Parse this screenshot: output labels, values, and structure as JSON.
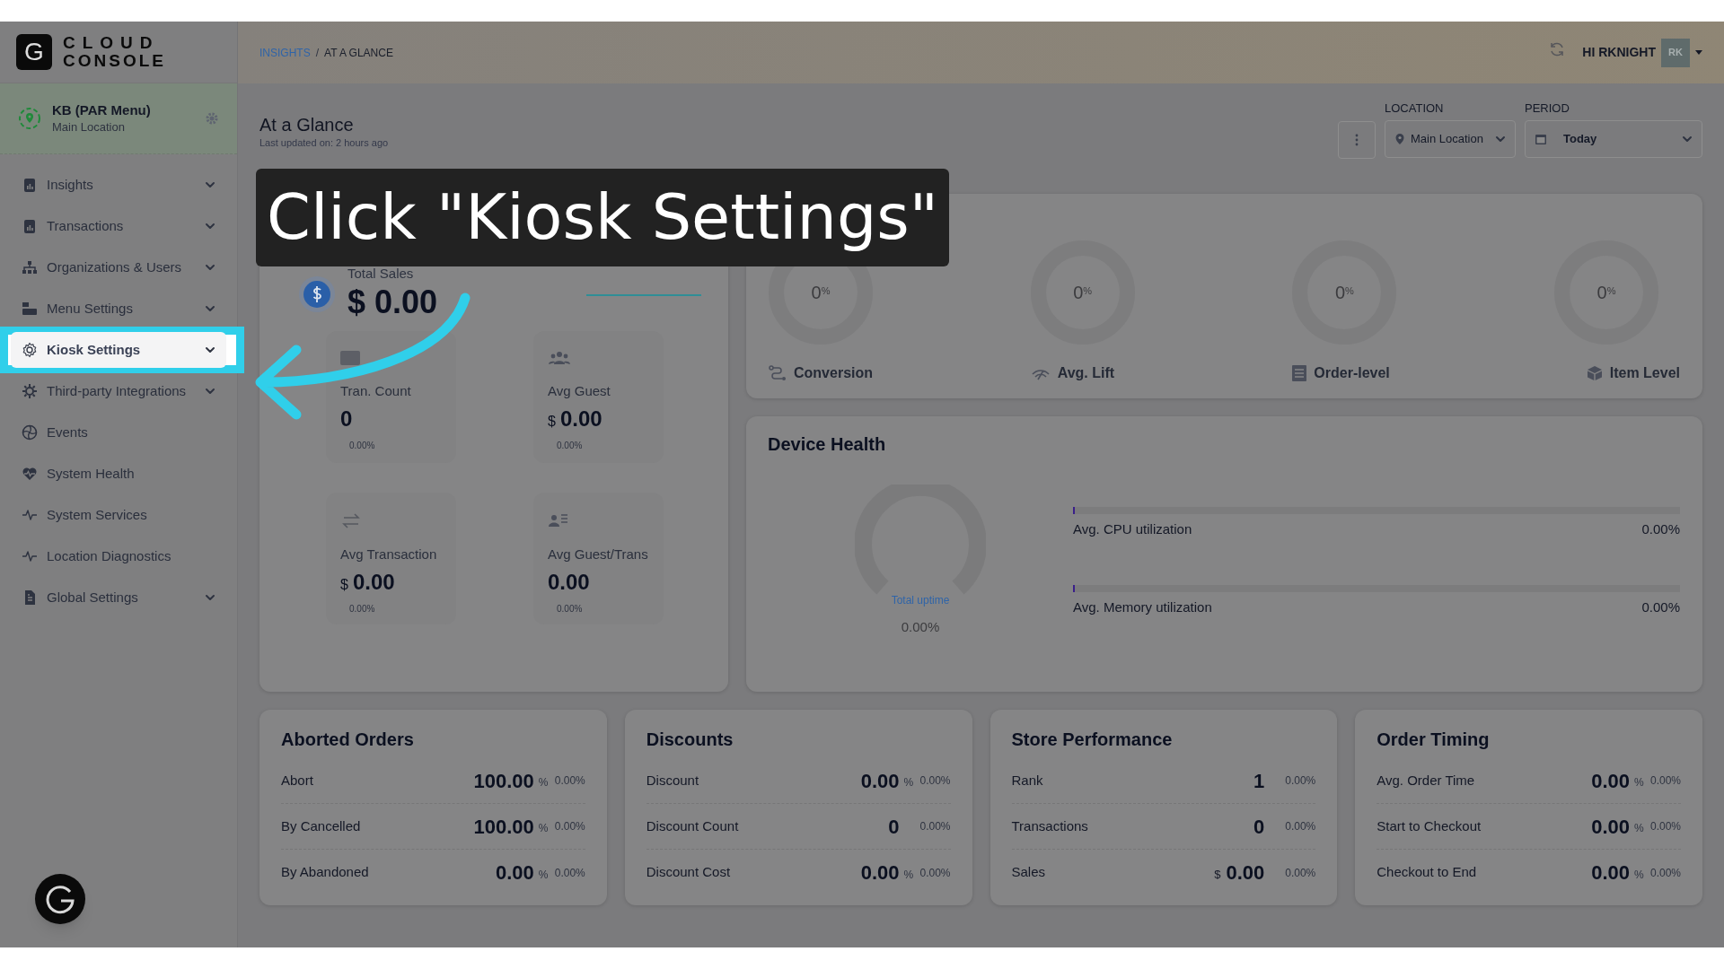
{
  "logo": {
    "mark": "G",
    "line1": "CLOUD",
    "line2": "CONSOLE"
  },
  "location_card": {
    "name": "KB (PAR Menu)",
    "subtitle": "Main Location"
  },
  "sidebar": {
    "items": [
      {
        "label": "Insights",
        "expandable": true,
        "selected": false
      },
      {
        "label": "Transactions",
        "expandable": true,
        "selected": false
      },
      {
        "label": "Organizations & Users",
        "expandable": true,
        "selected": false
      },
      {
        "label": "Menu Settings",
        "expandable": true,
        "selected": false
      },
      {
        "label": "Kiosk Settings",
        "expandable": true,
        "selected": true
      },
      {
        "label": "Third-party Integrations",
        "expandable": true,
        "selected": false
      },
      {
        "label": "Events",
        "expandable": false,
        "selected": false
      },
      {
        "label": "System Health",
        "expandable": false,
        "selected": false
      },
      {
        "label": "System Services",
        "expandable": false,
        "selected": false
      },
      {
        "label": "Location Diagnostics",
        "expandable": false,
        "selected": false
      },
      {
        "label": "Global Settings",
        "expandable": true,
        "selected": false
      }
    ]
  },
  "breadcrumb": {
    "items": [
      "INSIGHTS",
      "AT A GLANCE"
    ],
    "separator": "/"
  },
  "header": {
    "greeting": "HI RKNIGHT",
    "avatar": "RK"
  },
  "page": {
    "title": "At a Glance",
    "updated": "Last updated on: 2 hours ago"
  },
  "filters": [
    {
      "label": "LOCATION",
      "value": "Main Location"
    },
    {
      "label": "PERIOD",
      "value": "Today"
    }
  ],
  "sales": {
    "total_label": "Total Sales",
    "total": "$ 0.00",
    "metrics": [
      {
        "label": "Tran. Count",
        "value": "0",
        "change": "0.00%"
      },
      {
        "label": "Avg Guest",
        "prefix": "$",
        "value": "0.00",
        "change": "0.00%"
      },
      {
        "label": "Avg Transaction",
        "prefix": "$",
        "value": "0.00",
        "change": "0.00%"
      },
      {
        "label": "Avg Guest/Trans",
        "value": "0.00",
        "change": "0.00%"
      }
    ]
  },
  "upsells": [
    {
      "value": "0",
      "unit": "%",
      "label": "Conversion"
    },
    {
      "value": "0",
      "unit": "%",
      "label": "Avg. Lift"
    },
    {
      "value": "0",
      "unit": "%",
      "label": "Order-level"
    },
    {
      "value": "0",
      "unit": "%",
      "label": "Item Level"
    }
  ],
  "device_health": {
    "title": "Device Health",
    "uptime_label": "Total uptime",
    "uptime_value": "0.00%",
    "bars": [
      {
        "label": "Avg. CPU utilization",
        "value": "0.00%",
        "level": 0
      },
      {
        "label": "Avg. Memory utilization",
        "value": "0.00%",
        "level": 0
      }
    ]
  },
  "summary_cards": [
    {
      "title": "Aborted Orders",
      "rows": [
        {
          "label": "Abort",
          "value": "100.00",
          "unit": "%",
          "change": "0.00%"
        },
        {
          "label": "By Cancelled",
          "value": "100.00",
          "unit": "%",
          "change": "0.00%"
        },
        {
          "label": "By Abandoned",
          "value": "0.00",
          "unit": "%",
          "change": "0.00%"
        }
      ]
    },
    {
      "title": "Discounts",
      "rows": [
        {
          "label": "Discount",
          "value": "0.00",
          "unit": "%",
          "change": "0.00%"
        },
        {
          "label": "Discount Count",
          "value": "0",
          "change": "0.00%"
        },
        {
          "label": "Discount Cost",
          "value": "0.00",
          "unit": "%",
          "change": "0.00%"
        }
      ]
    },
    {
      "title": "Store Performance",
      "rows": [
        {
          "label": "Rank",
          "value": "1",
          "change": "0.00%"
        },
        {
          "label": "Transactions",
          "value": "0",
          "change": "0.00%"
        },
        {
          "label": "Sales",
          "prefix": "$",
          "value": "0.00",
          "change": "0.00%"
        }
      ]
    },
    {
      "title": "Order Timing",
      "rows": [
        {
          "label": "Avg. Order Time",
          "value": "0.00",
          "unit": "%",
          "change": "0.00%"
        },
        {
          "label": "Start to Checkout",
          "value": "0.00",
          "unit": "%",
          "change": "0.00%"
        },
        {
          "label": "Checkout to End",
          "value": "0.00",
          "unit": "%",
          "change": "0.00%"
        }
      ]
    }
  ],
  "tutorial": {
    "text": "Click \"Kiosk Settings\""
  }
}
